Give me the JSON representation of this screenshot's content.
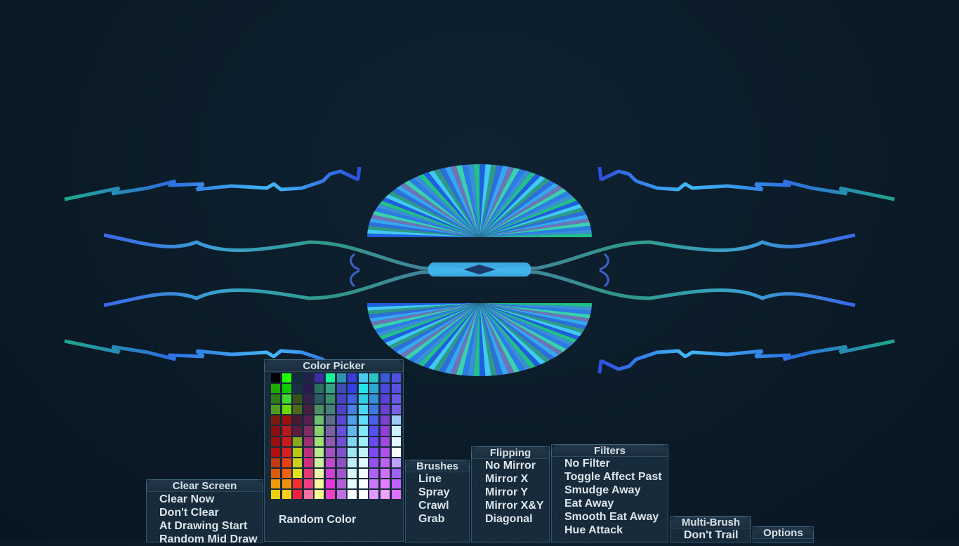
{
  "canvas": {
    "strokes": [
      "teal",
      "blue",
      "cyan",
      "purple-grey"
    ],
    "accent_colors": [
      "#1fa88a",
      "#2d6fe0",
      "#41b9f5",
      "#4d78a8"
    ]
  },
  "color_picker": {
    "title": "Color Picker",
    "random_label": "Random Color",
    "swatch_columns": [
      [
        "#000000",
        "#1fa800",
        "#2c7d16",
        "#4e9c1f",
        "#7a1a0f",
        "#8c0f0f",
        "#9c1010",
        "#b21010",
        "#c2380f",
        "#db5a0a",
        "#f09a0a",
        "#f0d00a"
      ],
      [
        "#21ff00",
        "#12c800",
        "#40d830",
        "#6cd800",
        "#a00f0f",
        "#b81818",
        "#cc1a1a",
        "#d92020",
        "#e84010",
        "#f06010",
        "#f09010",
        "#f8d020"
      ],
      [
        "#122a3c",
        "#1a3046",
        "#3a5018",
        "#50681a",
        "#4a1a30",
        "#5e1a3c",
        "#8aa61a",
        "#b4c818",
        "#cad020",
        "#e0e020",
        "#ef2f30",
        "#ee2040"
      ],
      [
        "#22204a",
        "#2a1a50",
        "#3a1e4a",
        "#481e40",
        "#56204a",
        "#7e2e60",
        "#9e2e70",
        "#bb3078",
        "#d02f80",
        "#e03a70",
        "#f04080",
        "#ff6fa0"
      ],
      [
        "#3d2ea0",
        "#2c6e5c",
        "#2a5a62",
        "#4e8e60",
        "#6ec070",
        "#8ad070",
        "#a0e070",
        "#b8e890",
        "#d0f0a0",
        "#ecf8b0",
        "#f8f8a0",
        "#ffff90"
      ],
      [
        "#16f29a",
        "#34a080",
        "#3c8e6a",
        "#4a7e7a",
        "#5e6e8a",
        "#7a62a0",
        "#9058b0",
        "#a650c0",
        "#c048c8",
        "#d040d0",
        "#e238d8",
        "#f040c0"
      ],
      [
        "#3090b0",
        "#404ab0",
        "#4a40c0",
        "#5440c8",
        "#5c48d0",
        "#6850d8",
        "#7050d0",
        "#8050c8",
        "#9050c0",
        "#a058c8",
        "#b060d0",
        "#c070e0"
      ],
      [
        "#3a3ad8",
        "#3440e0",
        "#4060e0",
        "#4880e8",
        "#50a0f0",
        "#60b8f0",
        "#80d8f0",
        "#a0e8f0",
        "#c0f0f8",
        "#d8f8f8",
        "#e8ffff",
        "#ffffff"
      ],
      [
        "#4ac8f0",
        "#28e0e8",
        "#30d0e0",
        "#48d8f0",
        "#60e0f8",
        "#80e8f8",
        "#a0f0f8",
        "#c0f4f8",
        "#e0f8ff",
        "#f0fcff",
        "#f8ffff",
        "#ffffff"
      ],
      [
        "#26c6c6",
        "#2aa8d0",
        "#3490d8",
        "#4078e0",
        "#4a60e8",
        "#5450f0",
        "#6a48f0",
        "#8048f0",
        "#9650f0",
        "#b060f8",
        "#c878f8",
        "#e098ff"
      ],
      [
        "#3a5ad8",
        "#4a48d8",
        "#5a40d8",
        "#6a40d0",
        "#8040d0",
        "#9040d8",
        "#a048e0",
        "#b050e8",
        "#c060f0",
        "#d070f8",
        "#e080ff",
        "#f0a0ff"
      ],
      [
        "#5050e0",
        "#5a50e0",
        "#6a58e8",
        "#7a60e8",
        "#a0c8f8",
        "#d0f0ff",
        "#e8f8ff",
        "#f8ffff",
        "#c0a0ff",
        "#a060ff",
        "#c060ff",
        "#e070ff"
      ]
    ]
  },
  "clear_screen": {
    "title": "Clear Screen",
    "items": [
      "Clear Now",
      "Don't Clear",
      "At Drawing Start",
      "Random Mid Draw"
    ]
  },
  "brushes": {
    "title": "Brushes",
    "items": [
      "Line",
      "Spray",
      "Crawl",
      "Grab"
    ]
  },
  "flipping": {
    "title": "Flipping",
    "items": [
      "No Mirror",
      "Mirror X",
      "Mirror Y",
      "Mirror X&Y",
      "Diagonal"
    ]
  },
  "filters": {
    "title": "Filters",
    "items": [
      "No Filter",
      "Toggle Affect Past",
      "Smudge Away",
      "Eat Away",
      "Smooth Eat Away",
      "Hue Attack"
    ]
  },
  "multi_brush": {
    "title": "Multi-Brush",
    "items": [
      "Don't Trail"
    ]
  },
  "options": {
    "title": "Options"
  }
}
